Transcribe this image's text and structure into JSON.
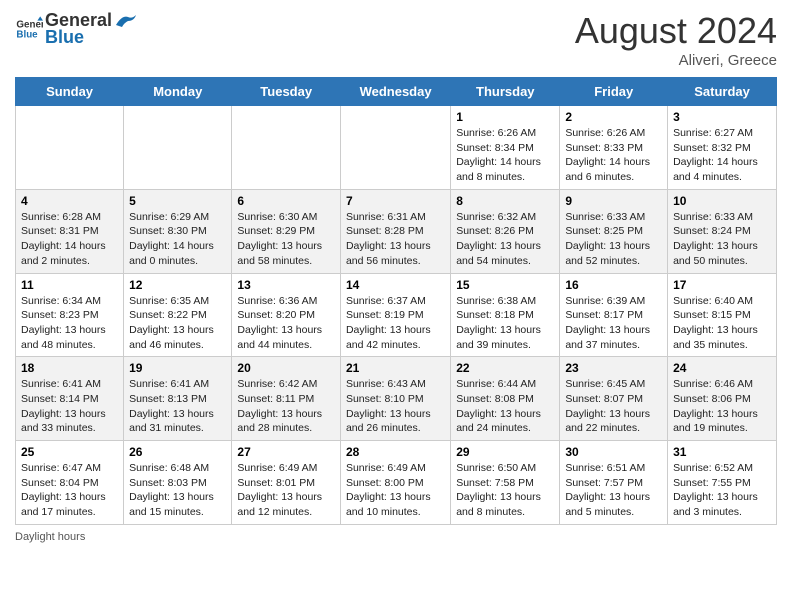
{
  "logo": {
    "line1": "General",
    "line2": "Blue"
  },
  "title": "August 2024",
  "subtitle": "Aliveri, Greece",
  "days_of_week": [
    "Sunday",
    "Monday",
    "Tuesday",
    "Wednesday",
    "Thursday",
    "Friday",
    "Saturday"
  ],
  "weeks": [
    [
      null,
      null,
      null,
      null,
      {
        "day": "1",
        "sunrise": "6:26 AM",
        "sunset": "8:34 PM",
        "daylight": "14 hours and 8 minutes."
      },
      {
        "day": "2",
        "sunrise": "6:26 AM",
        "sunset": "8:33 PM",
        "daylight": "14 hours and 6 minutes."
      },
      {
        "day": "3",
        "sunrise": "6:27 AM",
        "sunset": "8:32 PM",
        "daylight": "14 hours and 4 minutes."
      }
    ],
    [
      {
        "day": "4",
        "sunrise": "6:28 AM",
        "sunset": "8:31 PM",
        "daylight": "14 hours and 2 minutes."
      },
      {
        "day": "5",
        "sunrise": "6:29 AM",
        "sunset": "8:30 PM",
        "daylight": "14 hours and 0 minutes."
      },
      {
        "day": "6",
        "sunrise": "6:30 AM",
        "sunset": "8:29 PM",
        "daylight": "13 hours and 58 minutes."
      },
      {
        "day": "7",
        "sunrise": "6:31 AM",
        "sunset": "8:28 PM",
        "daylight": "13 hours and 56 minutes."
      },
      {
        "day": "8",
        "sunrise": "6:32 AM",
        "sunset": "8:26 PM",
        "daylight": "13 hours and 54 minutes."
      },
      {
        "day": "9",
        "sunrise": "6:33 AM",
        "sunset": "8:25 PM",
        "daylight": "13 hours and 52 minutes."
      },
      {
        "day": "10",
        "sunrise": "6:33 AM",
        "sunset": "8:24 PM",
        "daylight": "13 hours and 50 minutes."
      }
    ],
    [
      {
        "day": "11",
        "sunrise": "6:34 AM",
        "sunset": "8:23 PM",
        "daylight": "13 hours and 48 minutes."
      },
      {
        "day": "12",
        "sunrise": "6:35 AM",
        "sunset": "8:22 PM",
        "daylight": "13 hours and 46 minutes."
      },
      {
        "day": "13",
        "sunrise": "6:36 AM",
        "sunset": "8:20 PM",
        "daylight": "13 hours and 44 minutes."
      },
      {
        "day": "14",
        "sunrise": "6:37 AM",
        "sunset": "8:19 PM",
        "daylight": "13 hours and 42 minutes."
      },
      {
        "day": "15",
        "sunrise": "6:38 AM",
        "sunset": "8:18 PM",
        "daylight": "13 hours and 39 minutes."
      },
      {
        "day": "16",
        "sunrise": "6:39 AM",
        "sunset": "8:17 PM",
        "daylight": "13 hours and 37 minutes."
      },
      {
        "day": "17",
        "sunrise": "6:40 AM",
        "sunset": "8:15 PM",
        "daylight": "13 hours and 35 minutes."
      }
    ],
    [
      {
        "day": "18",
        "sunrise": "6:41 AM",
        "sunset": "8:14 PM",
        "daylight": "13 hours and 33 minutes."
      },
      {
        "day": "19",
        "sunrise": "6:41 AM",
        "sunset": "8:13 PM",
        "daylight": "13 hours and 31 minutes."
      },
      {
        "day": "20",
        "sunrise": "6:42 AM",
        "sunset": "8:11 PM",
        "daylight": "13 hours and 28 minutes."
      },
      {
        "day": "21",
        "sunrise": "6:43 AM",
        "sunset": "8:10 PM",
        "daylight": "13 hours and 26 minutes."
      },
      {
        "day": "22",
        "sunrise": "6:44 AM",
        "sunset": "8:08 PM",
        "daylight": "13 hours and 24 minutes."
      },
      {
        "day": "23",
        "sunrise": "6:45 AM",
        "sunset": "8:07 PM",
        "daylight": "13 hours and 22 minutes."
      },
      {
        "day": "24",
        "sunrise": "6:46 AM",
        "sunset": "8:06 PM",
        "daylight": "13 hours and 19 minutes."
      }
    ],
    [
      {
        "day": "25",
        "sunrise": "6:47 AM",
        "sunset": "8:04 PM",
        "daylight": "13 hours and 17 minutes."
      },
      {
        "day": "26",
        "sunrise": "6:48 AM",
        "sunset": "8:03 PM",
        "daylight": "13 hours and 15 minutes."
      },
      {
        "day": "27",
        "sunrise": "6:49 AM",
        "sunset": "8:01 PM",
        "daylight": "13 hours and 12 minutes."
      },
      {
        "day": "28",
        "sunrise": "6:49 AM",
        "sunset": "8:00 PM",
        "daylight": "13 hours and 10 minutes."
      },
      {
        "day": "29",
        "sunrise": "6:50 AM",
        "sunset": "7:58 PM",
        "daylight": "13 hours and 8 minutes."
      },
      {
        "day": "30",
        "sunrise": "6:51 AM",
        "sunset": "7:57 PM",
        "daylight": "13 hours and 5 minutes."
      },
      {
        "day": "31",
        "sunrise": "6:52 AM",
        "sunset": "7:55 PM",
        "daylight": "13 hours and 3 minutes."
      }
    ]
  ],
  "footer": {
    "daylight_label": "Daylight hours"
  }
}
